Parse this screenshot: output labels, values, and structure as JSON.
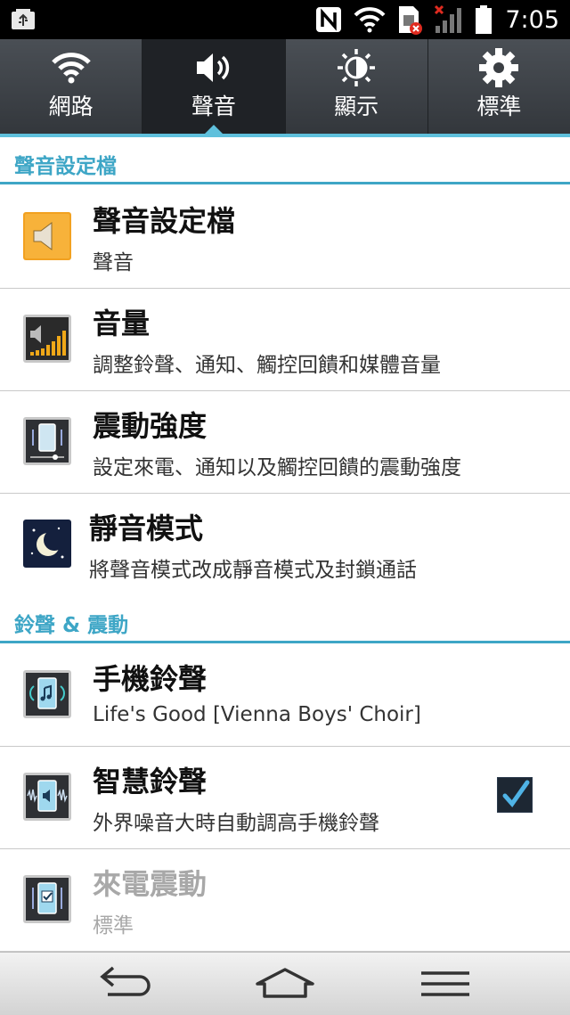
{
  "status_bar": {
    "time": "7:05",
    "icons": [
      "usb-icon",
      "nfc-icon",
      "wifi-icon",
      "sim-error-icon",
      "signal-icon",
      "battery-icon"
    ]
  },
  "quick_tabs": [
    {
      "label": "網路",
      "icon": "wifi-icon",
      "active": false
    },
    {
      "label": "聲音",
      "icon": "speaker-icon",
      "active": true
    },
    {
      "label": "顯示",
      "icon": "brightness-icon",
      "active": false
    },
    {
      "label": "標準",
      "icon": "gear-icon",
      "active": false
    }
  ],
  "sections": {
    "sound_profile": "聲音設定檔",
    "ringtone_vibration": "鈴聲 & 震動"
  },
  "items": [
    {
      "title": "聲音設定檔",
      "subtitle": "聲音",
      "icon": "sound-profile-icon"
    },
    {
      "title": "音量",
      "subtitle": "調整鈴聲、通知、觸控回饋和媒體音量",
      "icon": "volume-icon"
    },
    {
      "title": "震動強度",
      "subtitle": "設定來電、通知以及觸控回饋的震動強度",
      "icon": "vibration-strength-icon"
    },
    {
      "title": "靜音模式",
      "subtitle": "將聲音模式改成靜音模式及封鎖通話",
      "icon": "quiet-mode-icon"
    },
    {
      "title": "手機鈴聲",
      "subtitle": "Life's Good [Vienna Boys' Choir]",
      "icon": "ringtone-icon"
    },
    {
      "title": "智慧鈴聲",
      "subtitle": "外界噪音大時自動調高手機鈴聲",
      "icon": "smart-ringtone-icon",
      "checked": true
    },
    {
      "title": "來電震動",
      "subtitle": "標準",
      "icon": "incoming-vibration-icon",
      "enabled": false
    }
  ],
  "colors": {
    "accent": "#3ea6c6",
    "tab_bg": "#3a3e43",
    "tab_active": "#1f2226"
  }
}
